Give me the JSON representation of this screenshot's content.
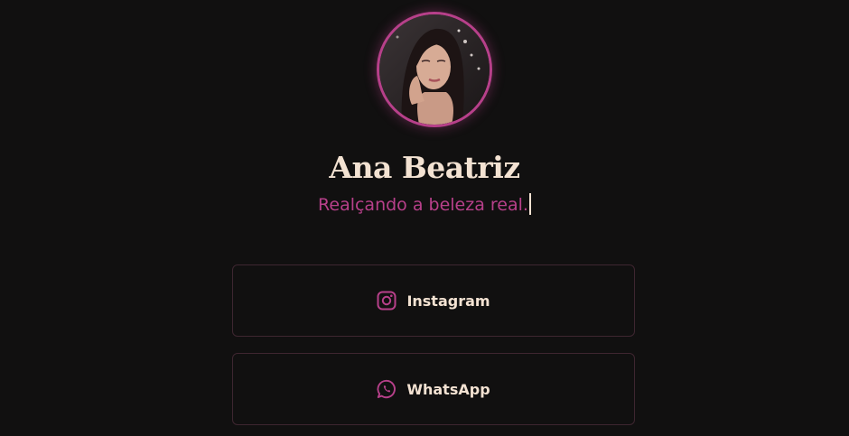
{
  "profile": {
    "name": "Ana Beatriz",
    "tagline": "Realçando a beleza real.",
    "avatar_icon": "profile-photo"
  },
  "links": [
    {
      "label": "Instagram",
      "icon": "instagram-icon"
    },
    {
      "label": "WhatsApp",
      "icon": "whatsapp-icon"
    }
  ],
  "colors": {
    "background": "#111010",
    "accent": "#b7408a",
    "text": "#f3e2d2",
    "button_border": "#3e2630"
  }
}
